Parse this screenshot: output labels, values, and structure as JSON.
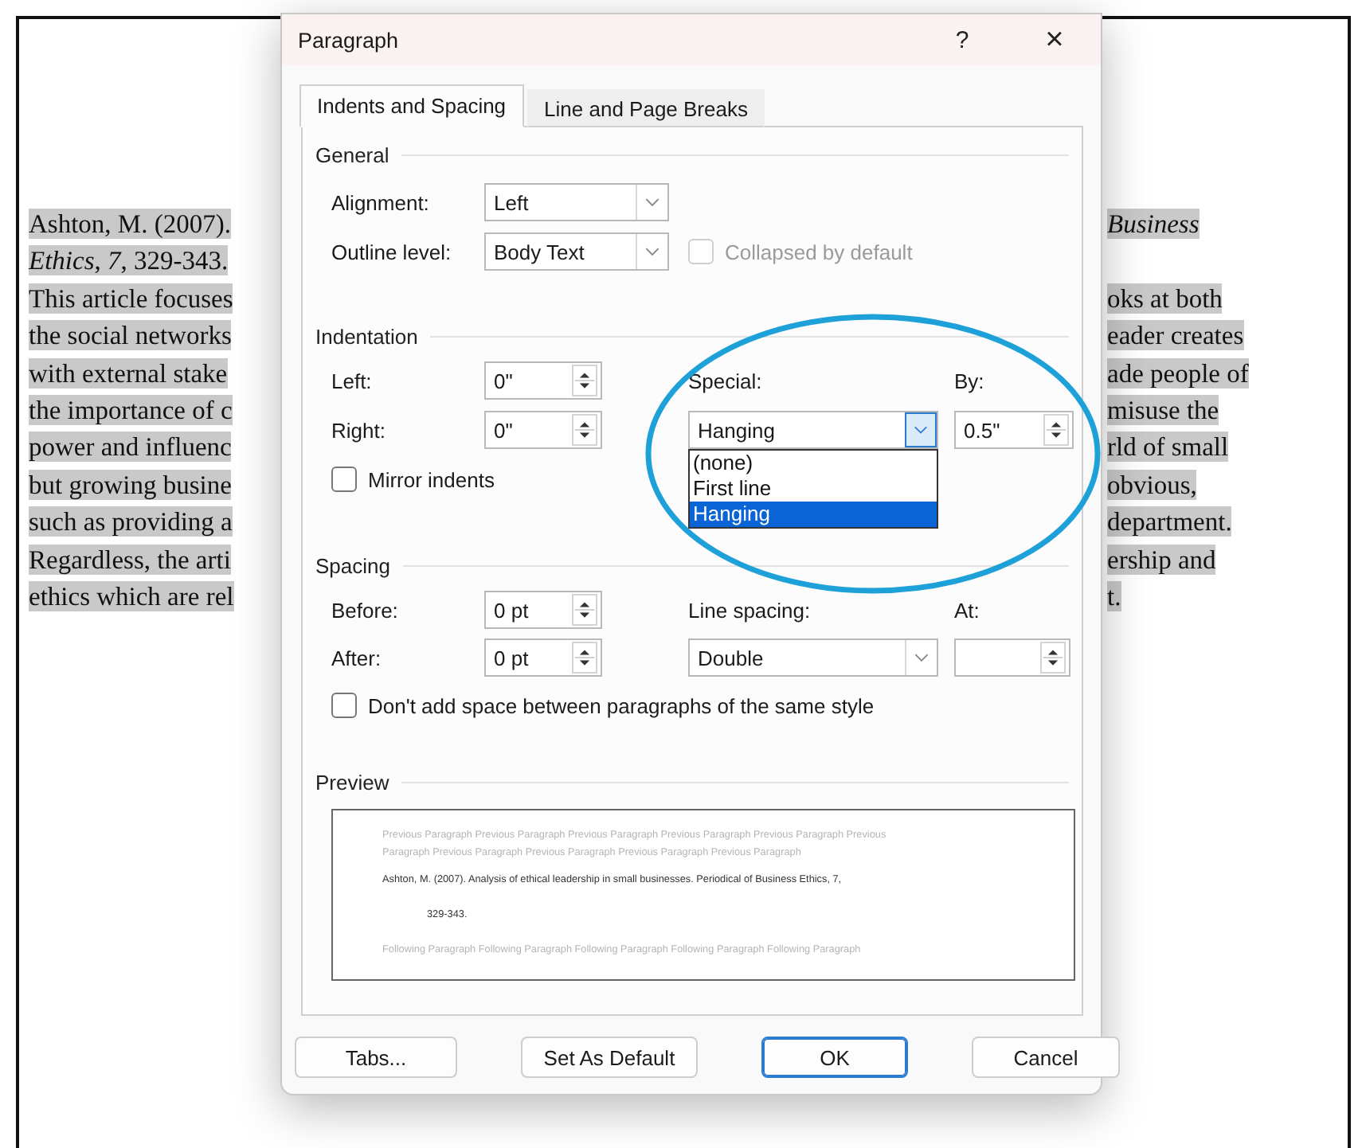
{
  "document": {
    "lines": [
      {
        "left": "Ashton, M. (2007).",
        "right": "*Business*"
      },
      {
        "left": "*Ethics*, *7*, 329-343."
      },
      {
        "left": "This article focuses",
        "right": "oks at both"
      },
      {
        "left": "the social networks",
        "right": "eader creates"
      },
      {
        "left": "with external stake",
        "right": "ade people of"
      },
      {
        "left": "the importance of c",
        "right": "misuse the"
      },
      {
        "left": "power and influenc",
        "right": "rld of small"
      },
      {
        "left": "but growing busine",
        "right": "obvious,"
      },
      {
        "left": "such as providing a",
        "right": "department."
      },
      {
        "left": "Regardless, the arti",
        "right": "ership and"
      },
      {
        "left": "ethics which are rel",
        "right": "t."
      }
    ]
  },
  "dialog": {
    "title": "Paragraph",
    "help_label": "?",
    "close_label": "×",
    "tabs": [
      {
        "label": "Indents and Spacing",
        "selected": true
      },
      {
        "label": "Line and Page Breaks",
        "selected": false
      }
    ],
    "general": {
      "heading": "General",
      "alignment": {
        "label": "Alignment:",
        "value": "Left",
        "expanded": false
      },
      "outline_level": {
        "label": "Outline level:",
        "value": "Body Text",
        "expanded": false
      },
      "collapsed": {
        "label": "Collapsed by default",
        "checked": false,
        "disabled": true
      }
    },
    "indentation": {
      "heading": "Indentation",
      "left": {
        "label": "Left:",
        "value": "0\""
      },
      "right": {
        "label": "Right:",
        "value": "0\""
      },
      "special": {
        "label": "Special:",
        "value": "Hanging",
        "expanded": true,
        "options": [
          {
            "label": "(none)",
            "selected": false
          },
          {
            "label": "First line",
            "selected": false
          },
          {
            "label": "Hanging",
            "selected": true
          }
        ]
      },
      "by": {
        "label": "By:",
        "value": "0.5\""
      },
      "mirror": {
        "label": "Mirror indents",
        "checked": false,
        "disabled": false
      }
    },
    "spacing": {
      "heading": "Spacing",
      "before": {
        "label": "Before:",
        "value": "0 pt"
      },
      "after": {
        "label": "After:",
        "value": "0 pt"
      },
      "line_spacing": {
        "label": "Line spacing:",
        "value": "Double",
        "expanded": false
      },
      "at": {
        "label": "At:"
      },
      "no_space": {
        "label": "Don't add space between paragraphs of the same style",
        "checked": false,
        "disabled": false
      }
    },
    "preview": {
      "heading": "Preview",
      "previous": [
        "Previous Paragraph Previous Paragraph Previous Paragraph Previous Paragraph Previous Paragraph Previous",
        "Paragraph Previous Paragraph Previous Paragraph Previous Paragraph Previous Paragraph"
      ],
      "current": [
        "Ashton, M. (2007). Analysis of ethical leadership in small businesses. Periodical of Business Ethics, 7,",
        "329-343."
      ],
      "following": [
        "Following Paragraph Following Paragraph Following Paragraph Following Paragraph Following Paragraph"
      ]
    },
    "buttons": [
      {
        "label": "Tabs...",
        "default": false
      },
      {
        "label": "Set As Default",
        "default": false
      },
      {
        "label": "OK",
        "default": true
      },
      {
        "label": "Cancel",
        "default": false
      }
    ]
  }
}
